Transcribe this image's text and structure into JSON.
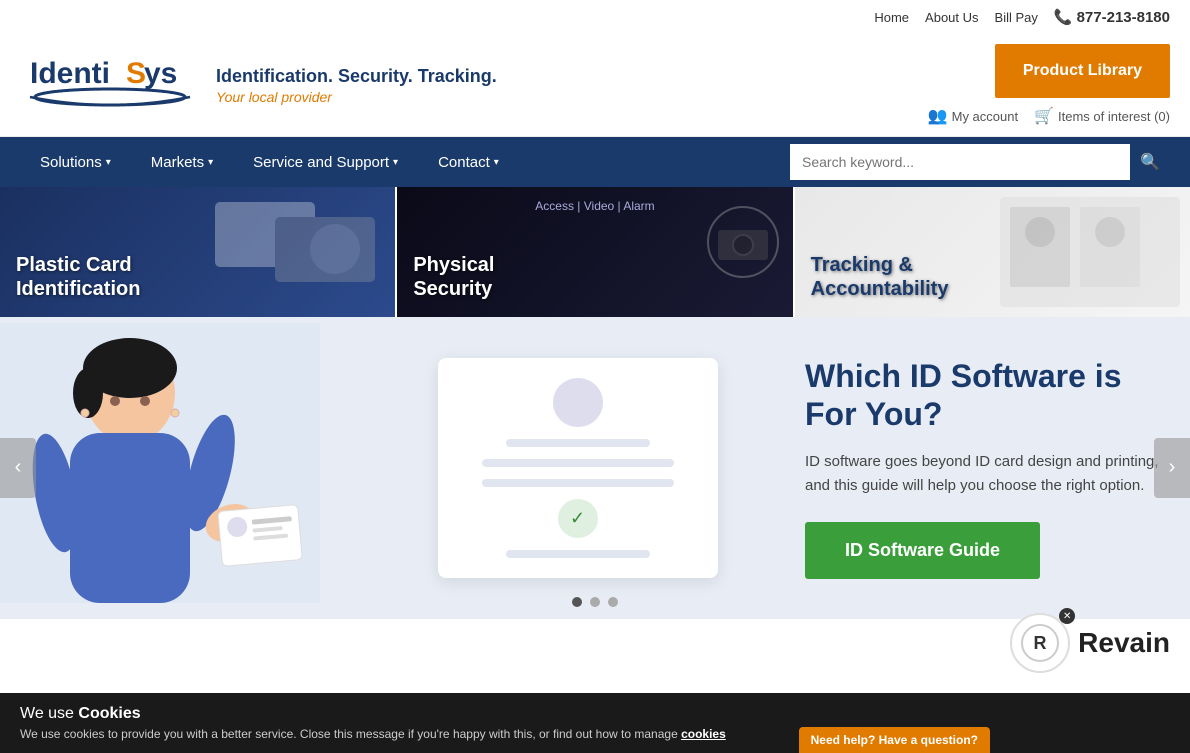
{
  "topbar": {
    "links": [
      "Home",
      "About Us",
      "Bill Pay"
    ],
    "phone": "877-213-8180"
  },
  "header": {
    "logo_text": "IdentiSys",
    "tagline_main": "Identification. Security. Tracking.",
    "tagline_sub": "Your local provider",
    "product_library_label": "Product Library",
    "my_account_label": "My account",
    "items_of_interest_label": "Items of interest (0)"
  },
  "nav": {
    "items": [
      {
        "label": "Solutions",
        "has_dropdown": true
      },
      {
        "label": "Markets",
        "has_dropdown": true
      },
      {
        "label": "Service and Support",
        "has_dropdown": true
      },
      {
        "label": "Contact",
        "has_dropdown": true
      }
    ],
    "search_placeholder": "Search keyword..."
  },
  "banners": [
    {
      "title": "Plastic Card",
      "subtitle": "Identification",
      "theme": "dark-blue"
    },
    {
      "title": "Physical",
      "subtitle": "Security",
      "sublabel": "Access | Video | Alarm",
      "theme": "dark"
    },
    {
      "title": "Tracking &",
      "subtitle": "Accountability",
      "theme": "light"
    }
  ],
  "hero": {
    "title": "Which ID Software is For You?",
    "description": "ID software goes beyond ID card design and printing, and this guide will help you choose the right option.",
    "button_label": "ID Software Guide",
    "dots": [
      {
        "active": true
      },
      {
        "active": false
      },
      {
        "active": false
      }
    ]
  },
  "cookie": {
    "prefix": "We use ",
    "highlight": "Cookies",
    "message": "We use cookies to provide you with a better service. Close this message if you're happy with this, or find out how to manage",
    "link_text": "cookies"
  },
  "revain": {
    "label": "Revain"
  },
  "live_chat": {
    "label": "Need help? Have a question?"
  }
}
